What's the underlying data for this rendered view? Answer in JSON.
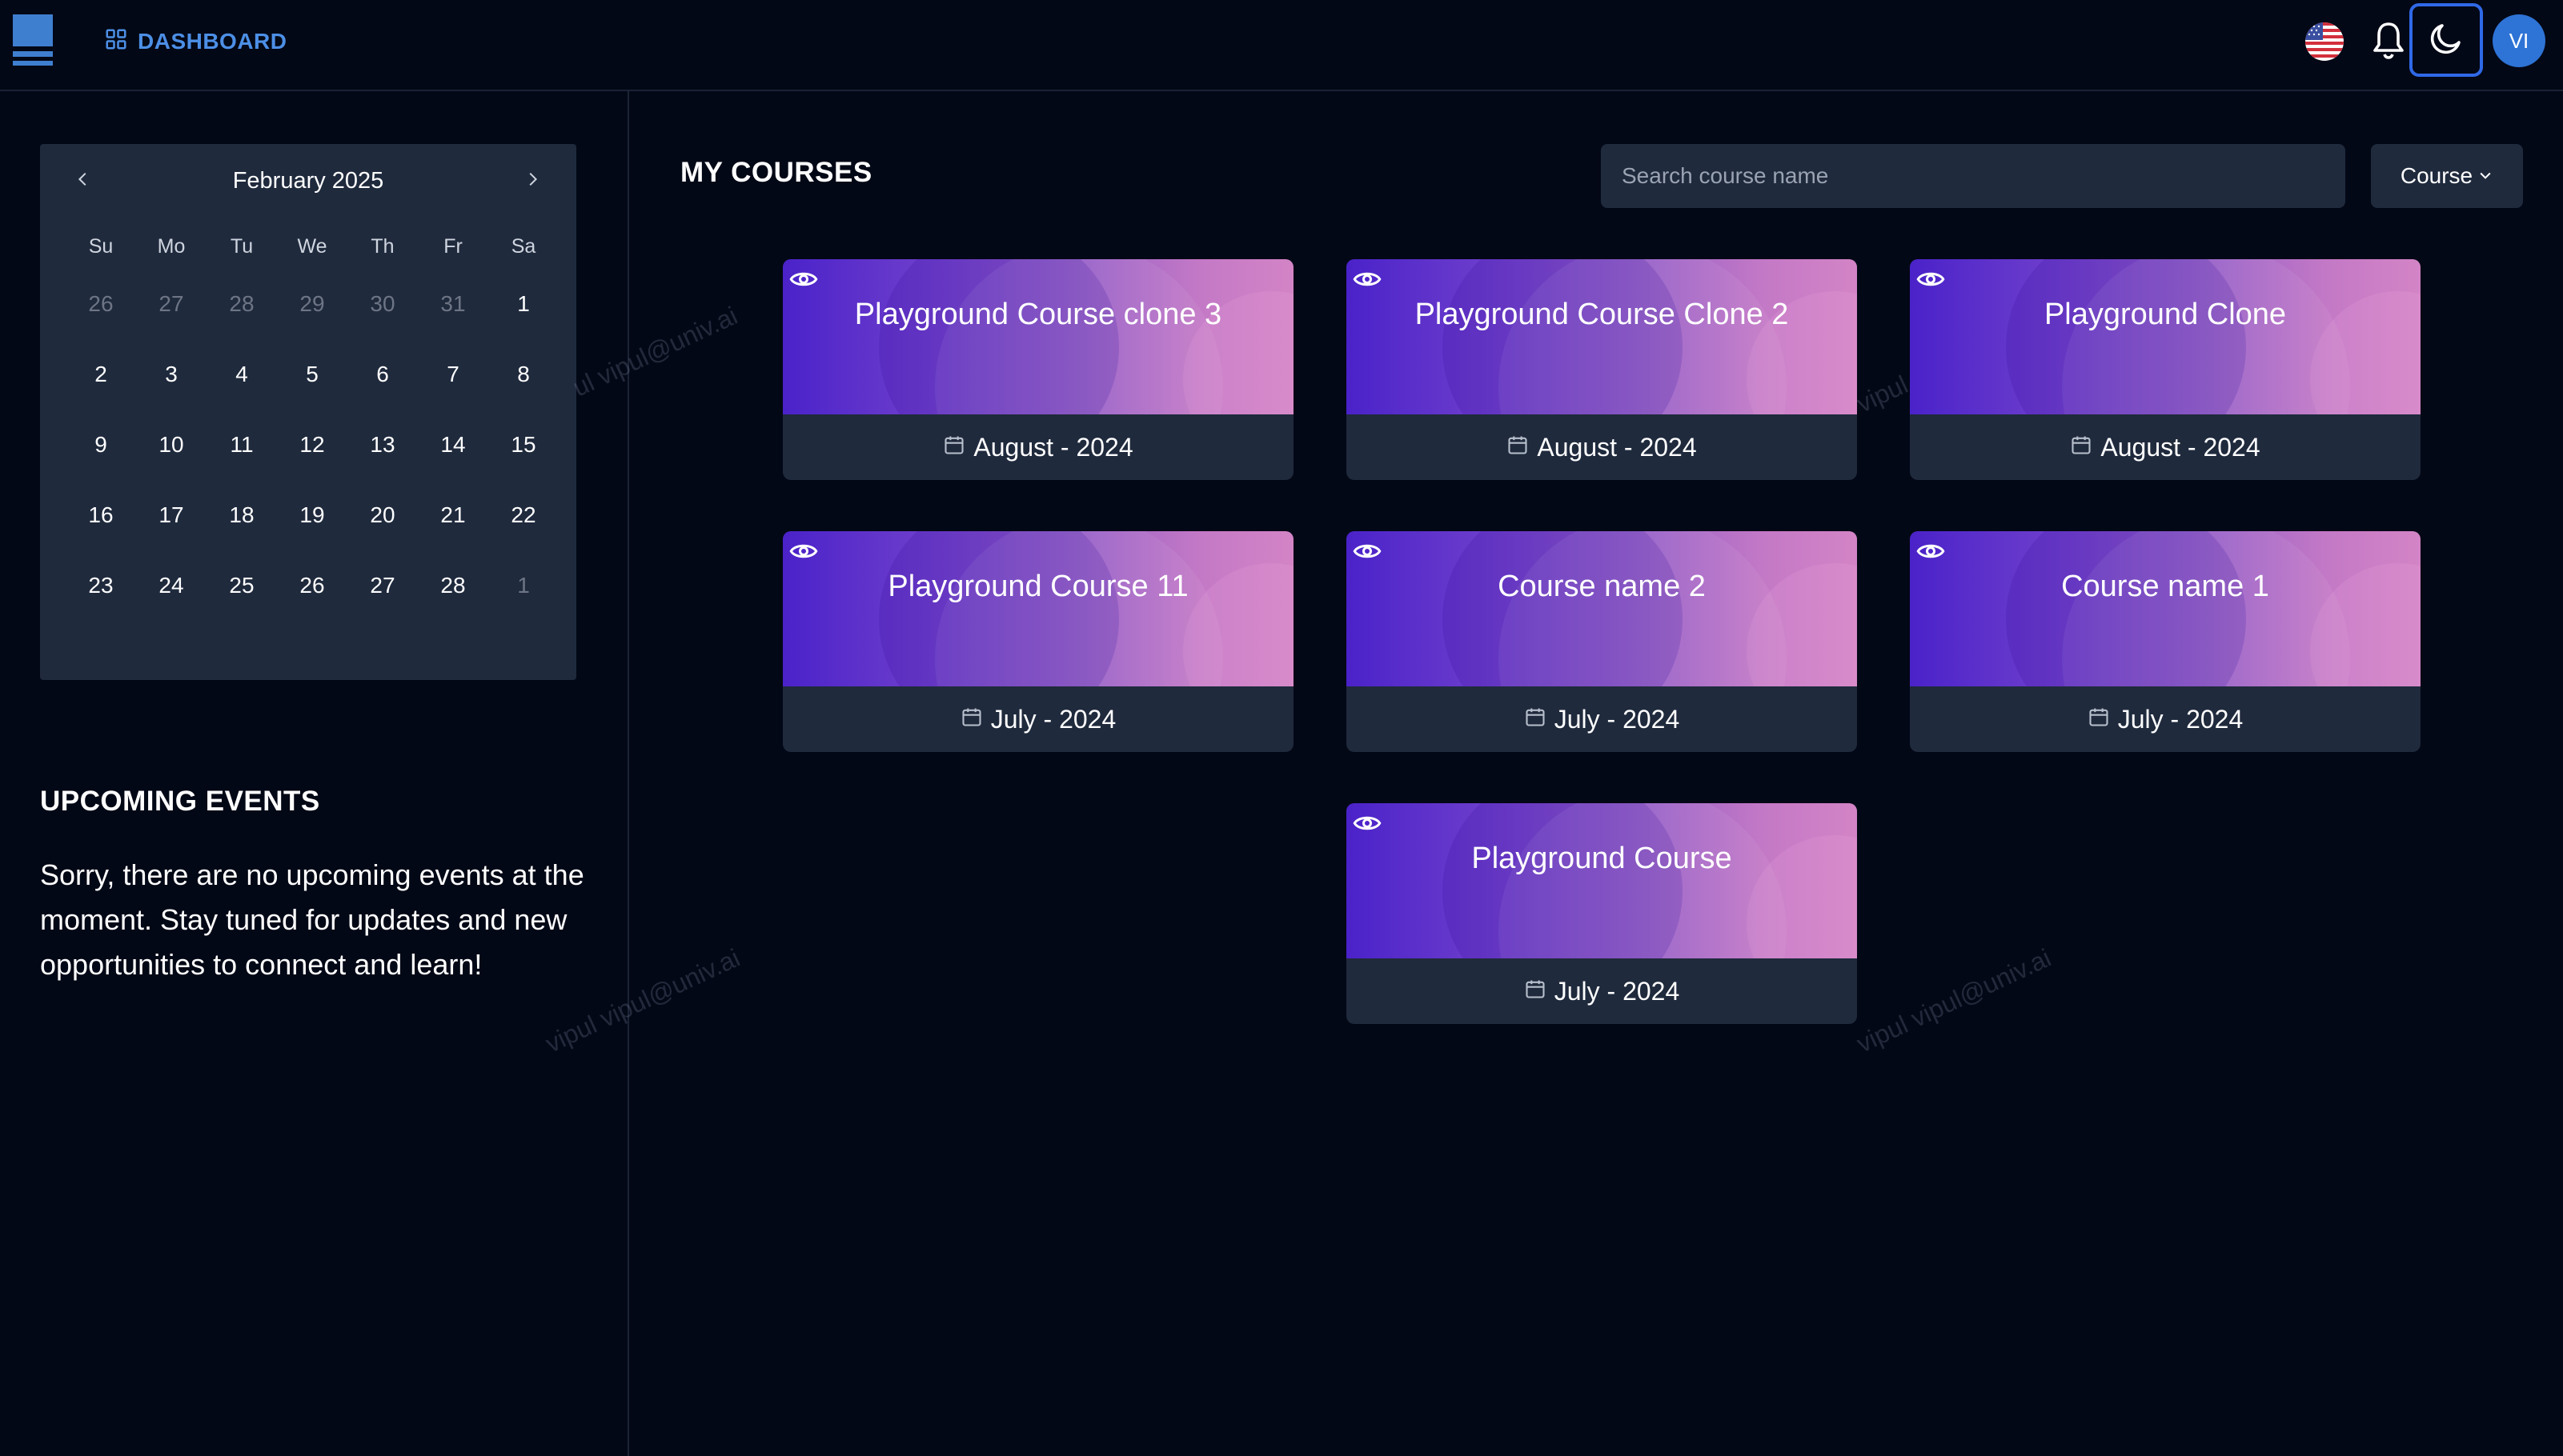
{
  "topbar": {
    "nav_label": "DASHBOARD",
    "avatar_initials": "VI",
    "icons": [
      "menu-logo",
      "grid-icon",
      "us-flag-icon",
      "bell-icon",
      "moon-icon"
    ]
  },
  "calendar": {
    "month_label": "February 2025",
    "weekdays": [
      "Su",
      "Mo",
      "Tu",
      "We",
      "Th",
      "Fr",
      "Sa"
    ],
    "weeks": [
      [
        "26",
        "27",
        "28",
        "29",
        "30",
        "31",
        "1"
      ],
      [
        "2",
        "3",
        "4",
        "5",
        "6",
        "7",
        "8"
      ],
      [
        "9",
        "10",
        "11",
        "12",
        "13",
        "14",
        "15"
      ],
      [
        "16",
        "17",
        "18",
        "19",
        "20",
        "21",
        "22"
      ],
      [
        "23",
        "24",
        "25",
        "26",
        "27",
        "28",
        "1"
      ]
    ],
    "muted_days": {
      "week0": [
        0,
        1,
        2,
        3,
        4,
        5
      ],
      "week4": [
        6
      ]
    }
  },
  "events": {
    "title": "UPCOMING EVENTS",
    "message": "Sorry, there are no upcoming events at the moment. Stay tuned for updates and new opportunities to connect and learn!"
  },
  "courses": {
    "title": "MY COURSES",
    "search_placeholder": "Search course name",
    "filter_label": "Course",
    "items": [
      {
        "name": "Playground Course clone 3",
        "date": "August - 2024"
      },
      {
        "name": "Playground Course Clone 2",
        "date": "August - 2024"
      },
      {
        "name": "Playground Clone",
        "date": "August - 2024"
      },
      {
        "name": "Playground Course 11",
        "date": "July - 2024"
      },
      {
        "name": "Course name 2",
        "date": "July - 2024"
      },
      {
        "name": "Course name 1",
        "date": "July - 2024"
      },
      {
        "name": "Playground Course",
        "date": "July - 2024"
      }
    ]
  },
  "watermark": {
    "left_top": "ul vipul@univ.ai",
    "left_bottom": "vipul vipul@univ.ai",
    "right_mid": "vipul",
    "right_bottom": "vipul vipul@univ.ai"
  },
  "colors": {
    "background": "#030816",
    "panel": "#1f2a3d",
    "accent": "#4c8fe6",
    "avatar": "#2e73d6"
  }
}
